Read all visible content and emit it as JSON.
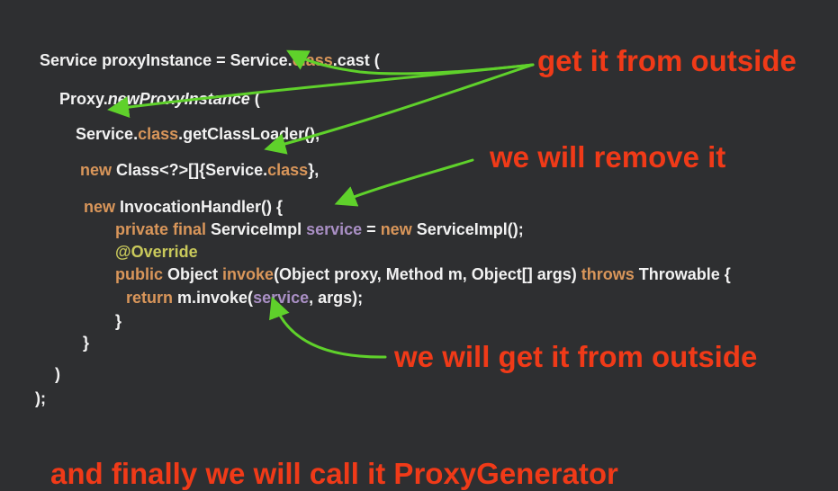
{
  "code": {
    "l1": {
      "a": "Service proxyInstance = Service.",
      "b": "class",
      "c": ".cast ("
    },
    "l2": {
      "a": "Proxy.",
      "b": "newProxyInstance",
      "c": " ("
    },
    "l3": {
      "a": "Service.",
      "b": "class",
      "c": ".getClassLoader(),"
    },
    "l4": {
      "a": "new",
      "b": " Class<?>[]{Service.",
      "c": "class",
      "d": "},"
    },
    "l5": {
      "a": "new",
      "b": " InvocationHandler() {"
    },
    "l6": {
      "a": "private final",
      "b": " ServiceImpl ",
      "c": "service",
      "d": " = ",
      "e": "new",
      "f": " ServiceImpl();"
    },
    "l7": {
      "a": "@Override"
    },
    "l8": {
      "a": "public",
      "b": " Object ",
      "c": "invoke",
      "d": "(Object proxy, Method m, Object[] args) ",
      "e": "throws",
      "f": " Throwable {"
    },
    "l9": {
      "a": "return",
      "b": " m.invoke(",
      "c": "service",
      "d": ", args);"
    },
    "l10": {
      "a": "}"
    },
    "l11": {
      "a": "}"
    },
    "l12": {
      "a": ")"
    },
    "l13": {
      "a": ");"
    }
  },
  "callouts": {
    "get_outside": "get it from outside",
    "remove": "we will remove it",
    "get_outside_2": "we will get it from outside",
    "finally": "and finally we will call it ProxyGenerator"
  },
  "colors": {
    "background": "#2e2f31",
    "code_text": "#f2f2f2",
    "keyword": "#d9965a",
    "variable": "#a98fc4",
    "annotation": "#c9c95b",
    "callout": "#f03a18",
    "arrow": "#5fd12b"
  }
}
